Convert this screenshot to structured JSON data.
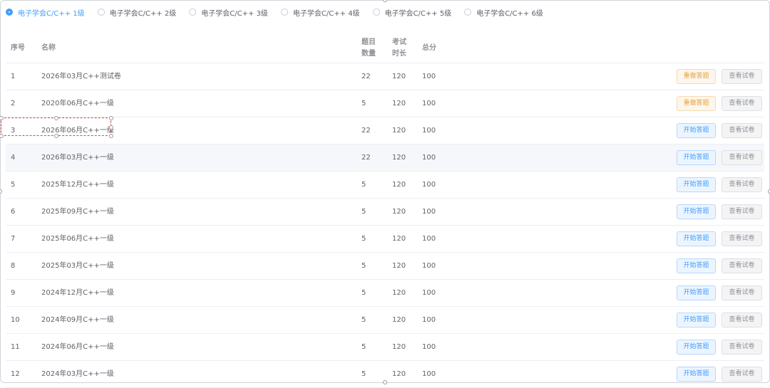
{
  "levels": [
    {
      "label": "电子学会C/C++ 1级",
      "selected": true
    },
    {
      "label": "电子学会C/C++ 2级",
      "selected": false
    },
    {
      "label": "电子学会C/C++ 3级",
      "selected": false
    },
    {
      "label": "电子学会C/C++ 4级",
      "selected": false
    },
    {
      "label": "电子学会C/C++ 5级",
      "selected": false
    },
    {
      "label": "电子学会C/C++ 6级",
      "selected": false
    }
  ],
  "columns": {
    "index": "序号",
    "name": "名称",
    "count_l1": "题目",
    "count_l2": "数量",
    "duration_l1": "考试",
    "duration_l2": "时长",
    "score": "总分"
  },
  "rows": [
    {
      "index": "1",
      "name": "2026年03月C++测试卷",
      "count": "22",
      "duration": "120",
      "score": "100",
      "action": "重做答题",
      "action_type": "redo",
      "view": "查看试卷"
    },
    {
      "index": "2",
      "name": "2020年06月C++一级",
      "count": "5",
      "duration": "120",
      "score": "100",
      "action": "重做答题",
      "action_type": "redo",
      "view": "查看试卷"
    },
    {
      "index": "3",
      "name": "2026年06月C++一级",
      "count": "22",
      "duration": "120",
      "score": "100",
      "action": "开始答题",
      "action_type": "start",
      "view": "查看试卷"
    },
    {
      "index": "4",
      "name": "2026年03月C++一级",
      "count": "22",
      "duration": "120",
      "score": "100",
      "action": "开始答题",
      "action_type": "start",
      "view": "查看试卷"
    },
    {
      "index": "5",
      "name": "2025年12月C++一级",
      "count": "5",
      "duration": "120",
      "score": "100",
      "action": "开始答题",
      "action_type": "start",
      "view": "查看试卷"
    },
    {
      "index": "6",
      "name": "2025年09月C++一级",
      "count": "5",
      "duration": "120",
      "score": "100",
      "action": "开始答题",
      "action_type": "start",
      "view": "查看试卷"
    },
    {
      "index": "7",
      "name": "2025年06月C++一级",
      "count": "5",
      "duration": "120",
      "score": "100",
      "action": "开始答题",
      "action_type": "start",
      "view": "查看试卷"
    },
    {
      "index": "8",
      "name": "2025年03月C++一级",
      "count": "5",
      "duration": "120",
      "score": "100",
      "action": "开始答题",
      "action_type": "start",
      "view": "查看试卷"
    },
    {
      "index": "9",
      "name": "2024年12月C++一级",
      "count": "5",
      "duration": "120",
      "score": "100",
      "action": "开始答题",
      "action_type": "start",
      "view": "查看试卷"
    },
    {
      "index": "10",
      "name": "2024年09月C++一级",
      "count": "5",
      "duration": "120",
      "score": "100",
      "action": "开始答题",
      "action_type": "start",
      "view": "查看试卷"
    },
    {
      "index": "11",
      "name": "2024年06月C++一级",
      "count": "5",
      "duration": "120",
      "score": "100",
      "action": "开始答题",
      "action_type": "start",
      "view": "查看试卷"
    },
    {
      "index": "12",
      "name": "2024年03月C++一级",
      "count": "5",
      "duration": "120",
      "score": "100",
      "action": "开始答题",
      "action_type": "start",
      "view": "查看试卷"
    }
  ],
  "colors": {
    "primary": "#409eff",
    "warning": "#e6a23c",
    "selection_border": "#e0453a",
    "row_hover": "#f5f7fa"
  }
}
